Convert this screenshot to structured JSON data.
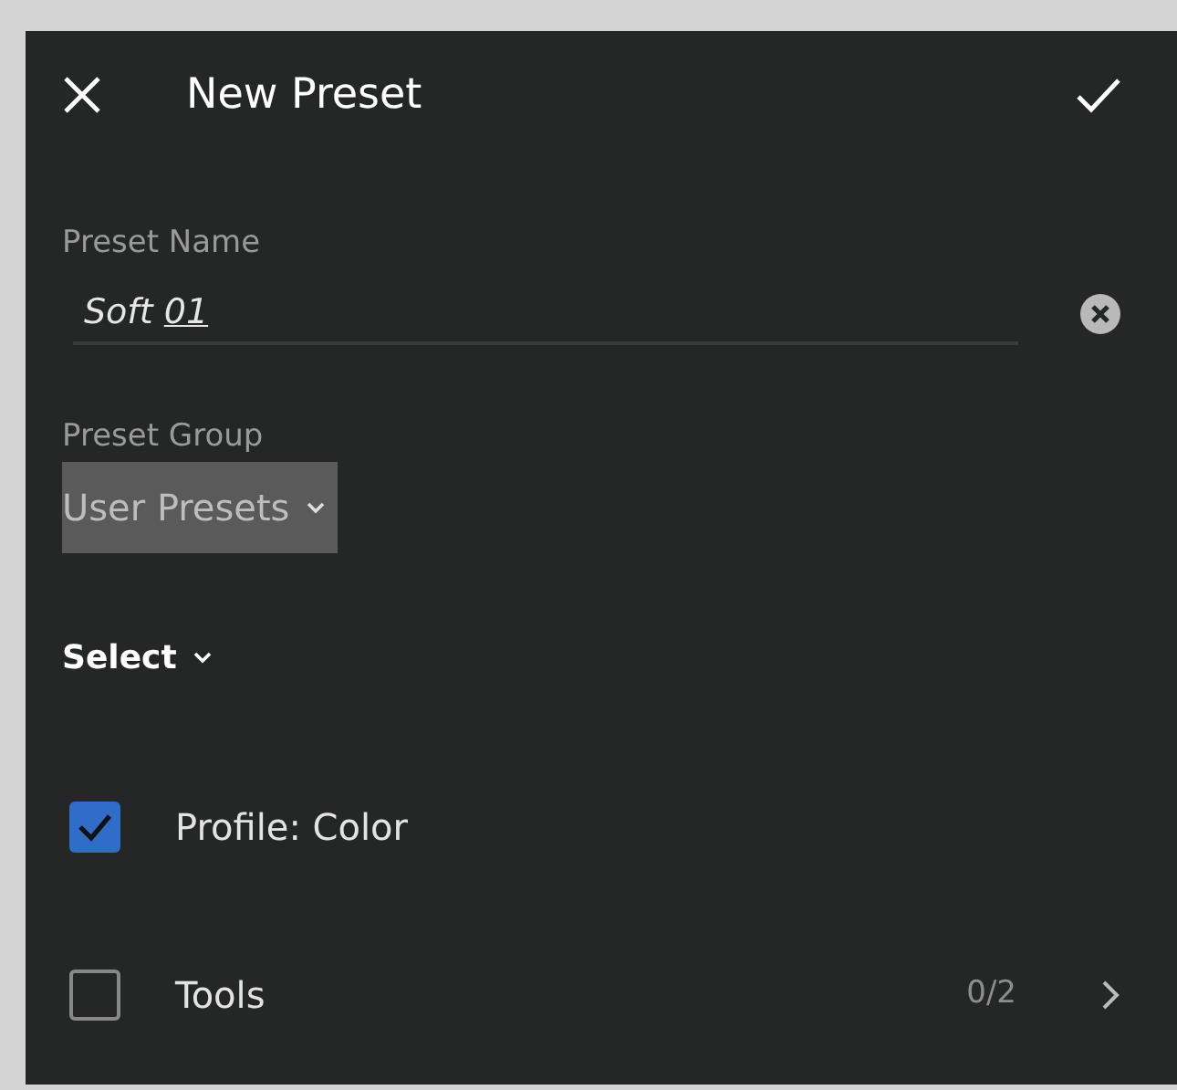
{
  "header": {
    "title": "New Preset"
  },
  "preset_name": {
    "label": "Preset Name",
    "value_parts": [
      {
        "text": "Soft",
        "underlined": false
      },
      {
        "text": "01",
        "underlined": true
      }
    ]
  },
  "preset_group": {
    "label": "Preset Group",
    "value": "User Presets"
  },
  "select": {
    "label": "Select"
  },
  "items": [
    {
      "label": "Profile: Color",
      "checked": true
    },
    {
      "label": "Tools",
      "checked": false,
      "count": "0/2"
    }
  ]
}
